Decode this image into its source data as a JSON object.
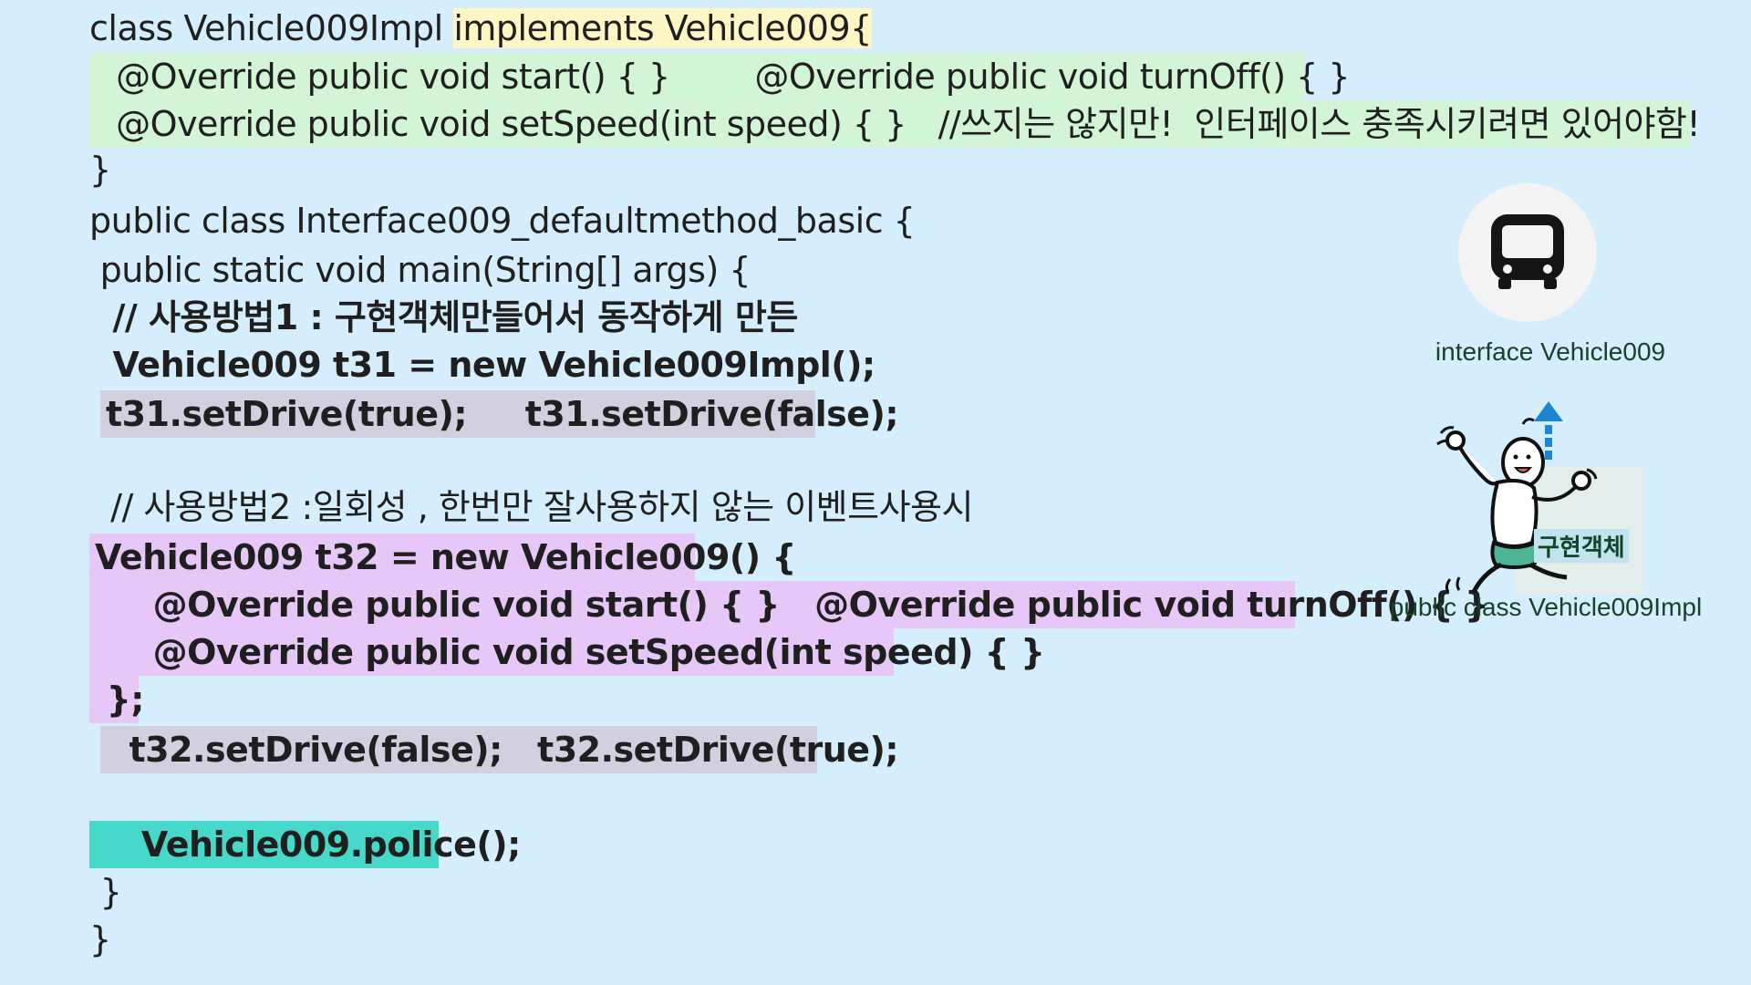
{
  "code": {
    "l1_a": "class Vehicle009Impl ",
    "l1_b": "implements Vehicle009{",
    "l2": "  @Override public void start() { }        @Override public void turnOff() { }",
    "l3": "  @Override public void setSpeed(int speed) { }   //쓰지는 않지만!  인터페이스 충족시키려면 있어야함!",
    "l4": "}",
    "l5": "public class Interface009_defaultmethod_basic {",
    "l6": " public static void main(String[] args) {",
    "l7": "  // 사용방법1 : 구현객체만들어서 동작하게 만든",
    "l8": "  Vehicle009 t31 = new Vehicle009Impl();",
    "l9": "t31.setDrive(true);     t31.setDrive(false);",
    "l10": "  // 사용방법2 :일회성 , 한번만 잘사용하지 않는 이벤트사용시",
    "l11": "Vehicle009 t32 = new Vehicle009() {",
    "l12": "     @Override public void start() { }   @Override public void turnOff() { }",
    "l13": "     @Override public void setSpeed(int speed) { }",
    "l14": " };",
    "l15": "  t32.setDrive(false);   t32.setDrive(true);",
    "l16": "    Vehicle009.police();",
    "l17": " }",
    "l18": "}"
  },
  "diagram": {
    "interface_label": "interface Vehicle009",
    "impl_tag": "구현객체",
    "impl_label": "public class Vehicle009Impl",
    "interface_icon": "bus-icon",
    "arrow_icon": "dashed-up-arrow-icon",
    "figure_icon": "dancing-character-illustration"
  },
  "colors": {
    "background": "#d4eefd",
    "highlight_yellow": "#fff6c6",
    "highlight_green": "#d2f5d6",
    "highlight_gray": "#d2d0e0",
    "highlight_pink": "#e6c7f7",
    "highlight_teal": "#46d9c9",
    "arrow_blue": "#1b86d6"
  }
}
